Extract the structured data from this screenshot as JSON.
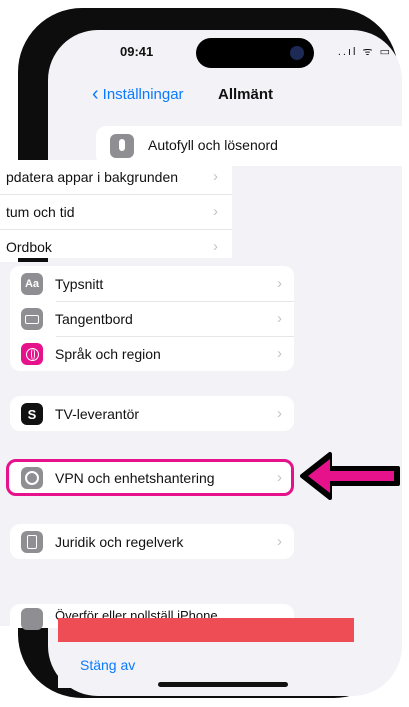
{
  "statusbar": {
    "time": "09:41",
    "icons": "..ıl ᯤ ▭"
  },
  "navbar": {
    "back_label": "Inställningar",
    "title": "Allmänt"
  },
  "autofill": {
    "label": "Autofyll och lösenord"
  },
  "strip_list": {
    "items": [
      {
        "label": "pdatera appar i bakgrunden"
      },
      {
        "label": "tum och tid"
      },
      {
        "label": "Ordbok"
      }
    ]
  },
  "settings": {
    "group1": [
      {
        "label": "Typsnitt",
        "icon": "Aa"
      },
      {
        "label": "Tangentbord",
        "icon": "keyboard-icon"
      },
      {
        "label": "Språk och region",
        "icon": "globe-icon"
      }
    ],
    "tv_provider": {
      "label": "TV-leverantör",
      "icon": "S"
    },
    "vpn": {
      "label": "VPN och enhetshantering",
      "icon": "gear-icon"
    },
    "legal": {
      "label": "Juridik och regelverk",
      "icon": "doc-icon"
    },
    "reset": {
      "label": "Överför eller nollställ iPhone"
    }
  },
  "bottom_sheet": {
    "turn_off_label": "Stäng av"
  },
  "colors": {
    "accent_pink": "#e5128c",
    "ios_blue": "#0a7aff",
    "bar_red": "#ef4d55"
  }
}
